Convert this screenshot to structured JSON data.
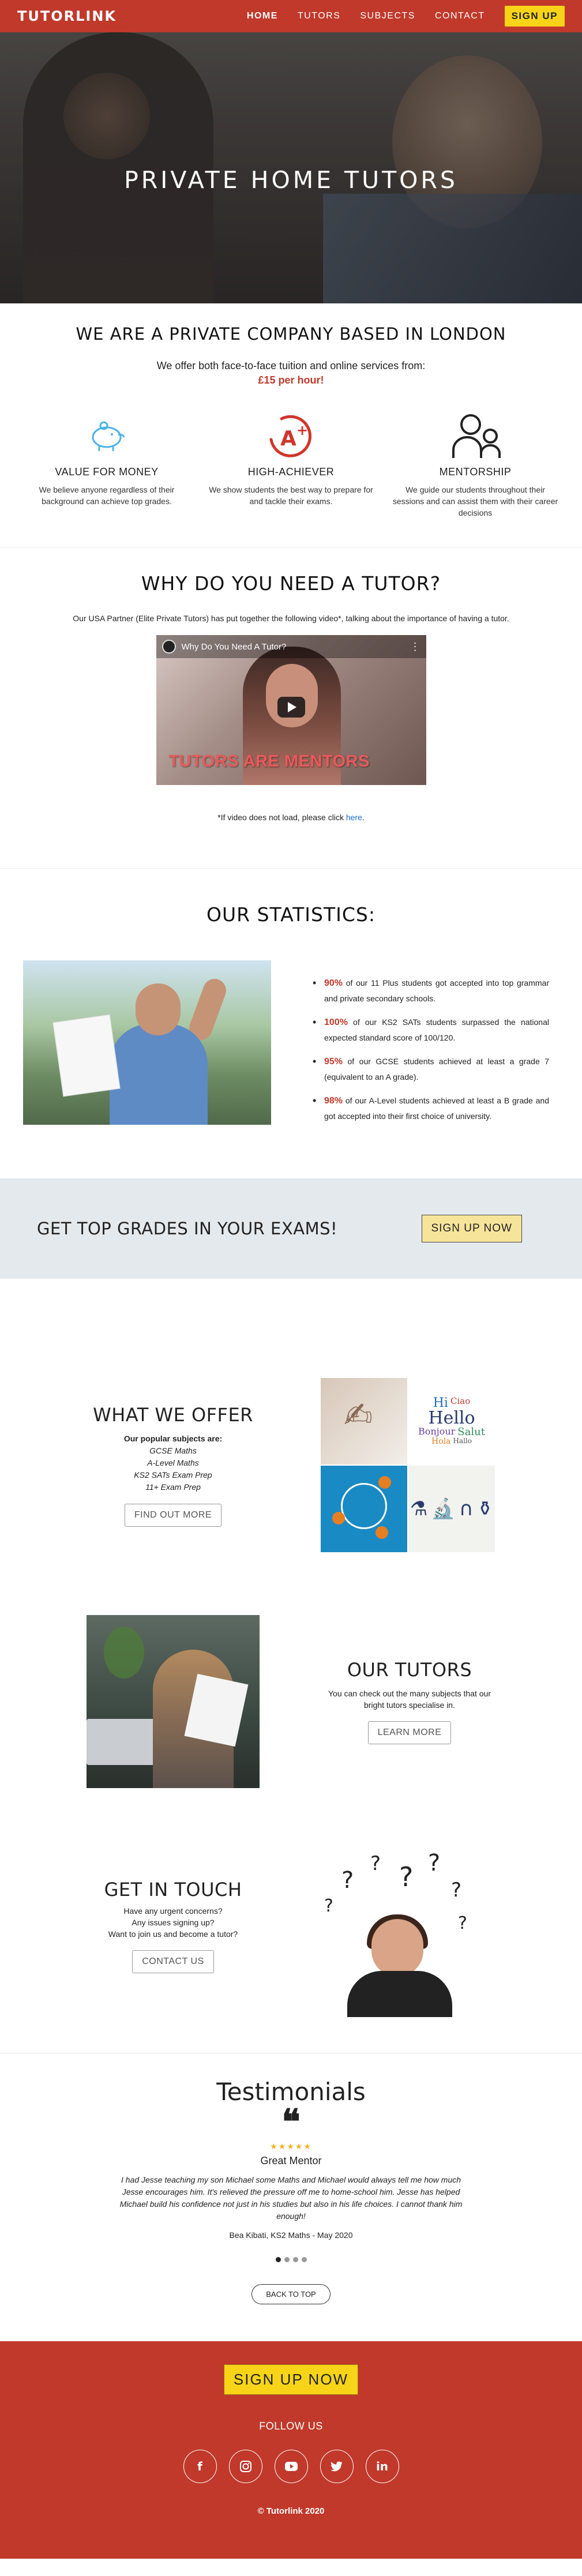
{
  "nav": {
    "logo": "TUTORLINK",
    "links": [
      "HOME",
      "TUTORS",
      "SUBJECTS",
      "CONTACT"
    ],
    "signup": "SIGN UP"
  },
  "hero": {
    "title": "PRIVATE HOME TUTORS"
  },
  "company": {
    "title": "WE ARE A PRIVATE COMPANY BASED IN LONDON",
    "intro": "We offer both face-to-face tuition and online services from:",
    "price": "£15 per hour!",
    "features": [
      {
        "title": "VALUE FOR MONEY",
        "text": "We believe anyone regardless of their background can achieve top grades.",
        "icon": "piggy-bank-icon"
      },
      {
        "title": "HIGH-ACHIEVER",
        "text": "We show students the best way to prepare for and tackle their exams.",
        "icon": "a-plus-icon"
      },
      {
        "title": "MENTORSHIP",
        "text": "We guide our students throughout their sessions and can assist them with their career decisions",
        "icon": "mentorship-icon"
      }
    ]
  },
  "video": {
    "title": "WHY DO YOU NEED A TUTOR?",
    "intro": "Our USA Partner (Elite Private Tutors) has put together the following video*, talking about the importance of having a tutor.",
    "player_title": "Why Do You Need A Tutor?",
    "caption": "TUTORS ARE MENTORS",
    "note_prefix": "*If video does not load, please click ",
    "note_link": "here",
    "note_suffix": "."
  },
  "stats": {
    "title": "OUR STATISTICS:",
    "items": [
      {
        "num": "90%",
        "text": " of our 11 Plus students got accepted into top grammar and private secondary schools."
      },
      {
        "num": "100%",
        "text": " of our KS2 SATs students surpassed the national expected standard score of 100/120."
      },
      {
        "num": "95%",
        "text": " of our GCSE students achieved at least a grade 7 (equivalent to an A grade)."
      },
      {
        "num": "98%",
        "text": " of our A-Level students achieved at least a B grade and got accepted into their first choice of university."
      }
    ]
  },
  "cta": {
    "text": "GET TOP GRADES IN YOUR EXAMS!",
    "button": "SIGN UP NOW"
  },
  "offer": {
    "title": "WHAT WE OFFER",
    "sub": "Our popular subjects are:",
    "subjects": [
      "GCSE Maths",
      "A-Level Maths",
      "KS2 SATs Exam Prep",
      "11+ Exam Prep"
    ],
    "button": "FIND OUT MORE"
  },
  "tutors": {
    "title": "OUR TUTORS",
    "text": "You can check out the many subjects that our bright tutors specialise in.",
    "button": "LEARN MORE"
  },
  "contact": {
    "title": "GET IN TOUCH",
    "lines": [
      "Have any urgent concerns?",
      "Any issues signing up?",
      "Want to join us and become a tutor?"
    ],
    "button": "CONTACT US"
  },
  "testimonials": {
    "title": "Testimonials",
    "quote_mark": "❝",
    "stars": "★★★★★",
    "heading": "Great Mentor",
    "text": "I had Jesse teaching my son Michael some Maths and Michael would always tell me how much Jesse encourages him. It's relieved the pressure off me to home-school him. Jesse has helped Michael build his confidence not just in his studies but also in his life choices. I cannot thank him enough!",
    "author": "Bea Kibati, KS2 Maths - May 2020",
    "back_top": "BACK TO TOP"
  },
  "footer": {
    "signup": "SIGN UP NOW",
    "follow": "FOLLOW US",
    "socials": [
      "facebook-icon",
      "instagram-icon",
      "youtube-icon",
      "twitter-icon",
      "linkedin-icon"
    ],
    "copyright": "© Tutorlink 2020"
  },
  "colors": {
    "brand": "#c0392b",
    "accent": "#f7d417"
  }
}
